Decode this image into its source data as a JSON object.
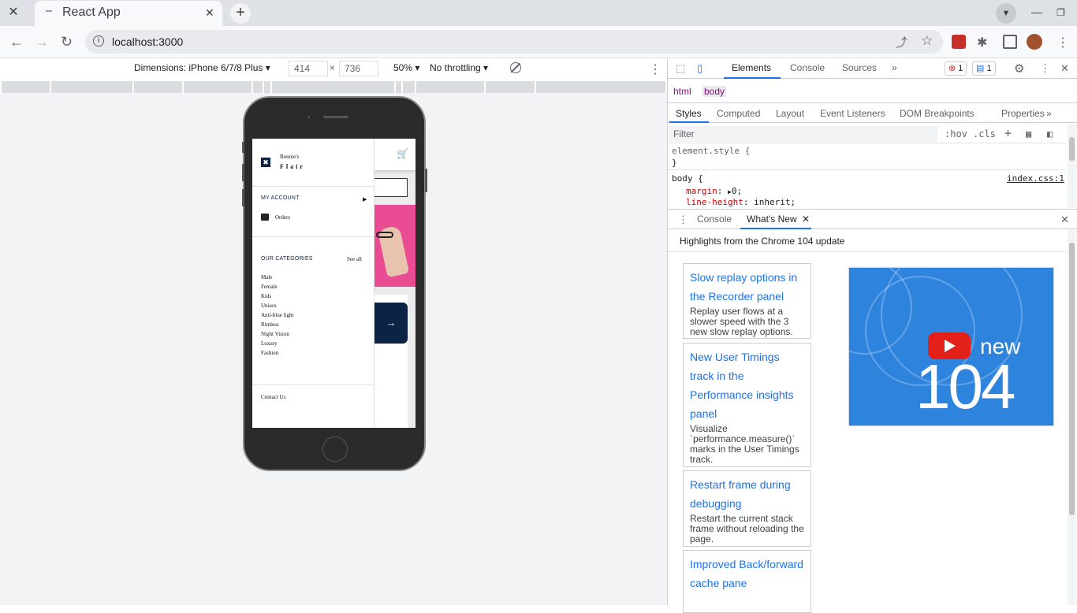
{
  "browser": {
    "tab_title": "React App",
    "url": "localhost:3000"
  },
  "device_toolbar": {
    "dimensions_label": "Dimensions: iPhone 6/7/8 Plus ▾",
    "width": "414",
    "times": "×",
    "height": "736",
    "zoom": "50% ▾",
    "throttling": "No throttling ▾"
  },
  "app": {
    "brand_line1": "Bonnie's",
    "brand_line2": "Flair",
    "my_account": "MY ACCOUNT",
    "orders": "Orders",
    "our_categories": "OUR CATEGORIES",
    "see_all": "See all",
    "categories": [
      "Male",
      "Female",
      "Kids",
      "Unisex",
      "Anti-blue light",
      "Rimless",
      "Night Vision",
      "Luxury",
      "Fashion"
    ],
    "contact_us": "Contact Us",
    "banner_arrow": "→"
  },
  "devtools": {
    "tabs": [
      "Elements",
      "Console",
      "Sources"
    ],
    "more": "»",
    "error_count": "1",
    "message_count": "1",
    "breadcrumbs": [
      "html",
      "body"
    ],
    "subtabs": [
      "Styles",
      "Computed",
      "Layout",
      "Event Listeners",
      "DOM Breakpoints",
      "Properties"
    ],
    "filter_placeholder": "Filter",
    "hov": ":hov",
    "cls": ".cls",
    "styles": {
      "element_style": "element.style {",
      "close_brace": "}",
      "body_selector": "body {",
      "source": "index.css:1",
      "prop1_name": "margin",
      "prop1_value": "0;",
      "prop2_name": "line-height",
      "prop2_value": "inherit;"
    },
    "drawer_tabs": [
      "Console",
      "What's New"
    ],
    "whats_new_heading": "Highlights from the Chrome 104 update",
    "cards": [
      {
        "title": "Slow replay options in the Recorder panel",
        "desc": "Replay user flows at a slower speed with the 3 new slow replay options."
      },
      {
        "title": "New User Timings track in the Performance insights panel",
        "desc": "Visualize `performance.measure()` marks in the User Timings track."
      },
      {
        "title": "Restart frame during debugging",
        "desc": "Restart the current stack frame without reloading the page."
      },
      {
        "title": "Improved Back/forward cache pane",
        "desc": ""
      }
    ],
    "video": {
      "new": "new",
      "version": "104"
    }
  },
  "colors": {
    "accent": "#1a73e8",
    "brand_navy": "#0b2345",
    "hero_pink": "#e94c93",
    "error_red": "#d93025"
  }
}
